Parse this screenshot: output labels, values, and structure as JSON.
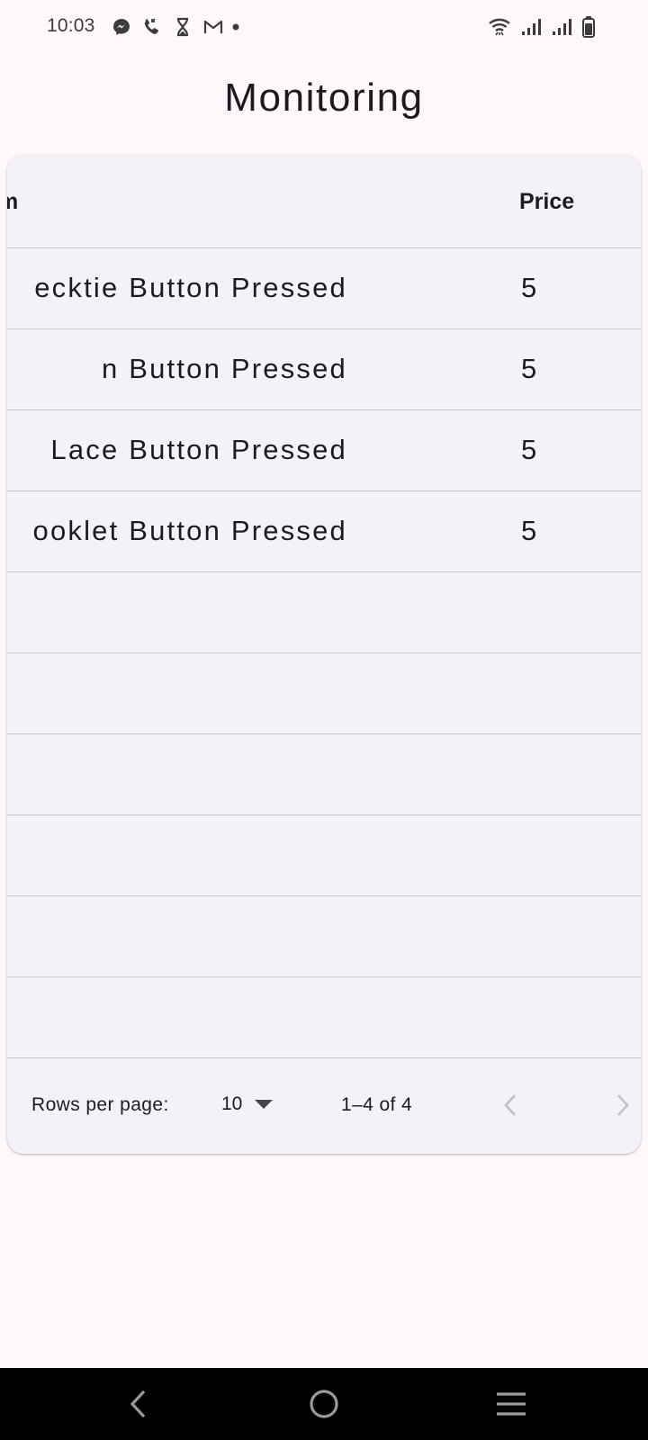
{
  "status_bar": {
    "time": "10:03",
    "left_icons": [
      "messenger-icon",
      "phone-call-icon",
      "hourglass-icon",
      "gmail-icon",
      "dot-icon"
    ],
    "right_icons": [
      "wifi-icon",
      "signal-icon",
      "signal-icon",
      "battery-icon"
    ]
  },
  "page": {
    "title": "Monitoring"
  },
  "table": {
    "columns": {
      "item": "m",
      "price": "Price"
    },
    "rows": [
      {
        "item": "ecktie Button Pressed",
        "price": "5"
      },
      {
        "item": "n Button Pressed",
        "price": "5"
      },
      {
        "item": "Lace Button Pressed",
        "price": "5"
      },
      {
        "item": "ooklet Button Pressed",
        "price": "5"
      }
    ],
    "empty_rows": 6
  },
  "pagination": {
    "rows_per_page_label": "Rows per page:",
    "rows_per_page_value": "10",
    "range_text": "1–4 of 4"
  },
  "nav_bar": {
    "buttons": [
      "back-icon",
      "home-icon",
      "recents-icon"
    ]
  },
  "colors": {
    "background": "#fef8fc",
    "card": "#f4f1f7",
    "divider": "#c9c5cc",
    "text": "#1d1b20",
    "disabled": "#c4c0c8"
  }
}
